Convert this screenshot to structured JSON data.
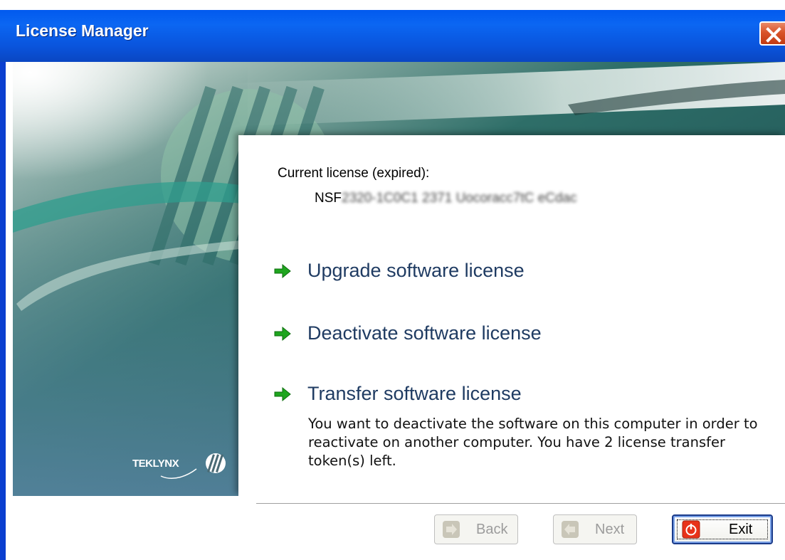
{
  "window": {
    "title": "License Manager",
    "close_icon": "close-icon"
  },
  "branding": {
    "logo_text": "TEKLYNX"
  },
  "license": {
    "current_label": "Current license (expired):",
    "key_prefix": "NSF",
    "key_obscured": "2320-1C0C1 2371 Uocoracc7tC eCdac"
  },
  "actions": [
    {
      "label": "Upgrade software license",
      "icon": "green-arrow-icon"
    },
    {
      "label": "Deactivate software license",
      "icon": "green-arrow-icon"
    },
    {
      "label": "Transfer software license",
      "icon": "green-arrow-icon"
    }
  ],
  "transfer_description": "You want to deactivate the software on this computer in order to reactivate on another computer. You have 2 license transfer token(s) left.",
  "buttons": {
    "back": {
      "label": "Back",
      "enabled": false
    },
    "next": {
      "label": "Next",
      "enabled": false
    },
    "exit": {
      "label": "Exit",
      "enabled": true
    }
  },
  "colors": {
    "titlebar_blue": "#0058ee",
    "link_text": "#1f3b62",
    "arrow_green": "#1fa51f",
    "close_red": "#d9542a"
  }
}
